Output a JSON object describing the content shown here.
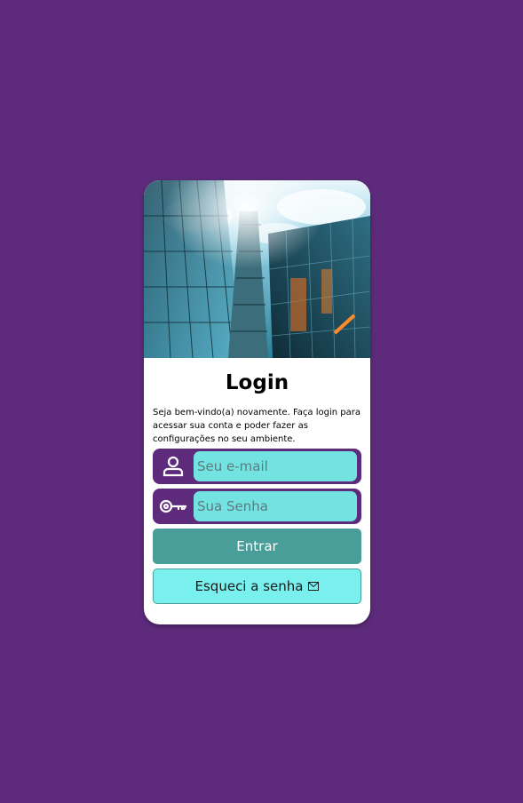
{
  "login": {
    "title": "Login",
    "description": "Seja bem-vindo(a) novamente. Faça login para acessar sua conta e poder fazer as configurações no seu ambiente.",
    "email_placeholder": "Seu e-mail",
    "password_placeholder": "Sua Senha",
    "submit_label": "Entrar",
    "forgot_label": "Esqueci a senha"
  },
  "icons": {
    "email_field": "user-icon",
    "password_field": "key-icon",
    "forgot_button": "envelope-icon"
  },
  "colors": {
    "background": "#5e2b7c",
    "input_fill": "#73e3e1",
    "primary_button": "#4a9e9a",
    "secondary_button": "#7af0ee"
  }
}
